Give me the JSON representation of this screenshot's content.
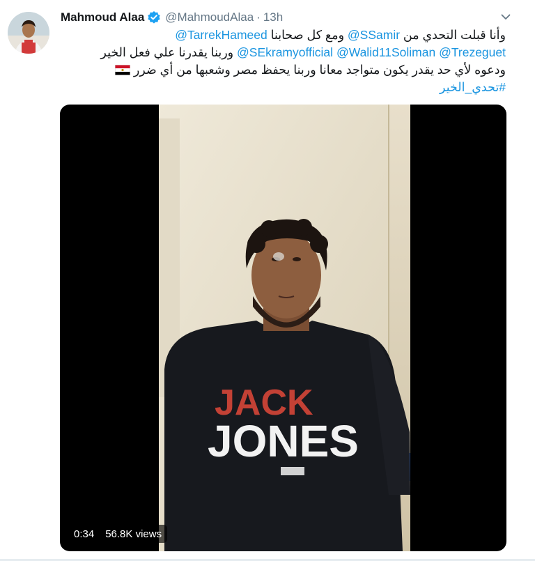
{
  "tweet": {
    "display_name": "Mahmoud Alaa",
    "handle": "@MahmoudAlaa",
    "separator": "·",
    "time": "13h",
    "text": {
      "line1_prefix": "وأنا قبلت التحدي من",
      "line1_mention1": "@SSamir",
      "line1_middle": "ومع كل صحابنا",
      "line1_mention2": "@TarrekHameed",
      "line2_mention1": "@Trezeguet",
      "line2_mention2": "@Walid11Soliman",
      "line2_mention3": "@SEkramyofficial",
      "line2_suffix": "وربنا يقدرنا علي فعل الخير",
      "line3": "ودعوه لأي حد يقدر يكون متواجد معانا وربنا يحفظ مصر وشعبها من أي ضرر",
      "hashtag": "#تحدي_الخير"
    },
    "media": {
      "duration": "0:34",
      "views": "56.8K views"
    }
  },
  "colors": {
    "link": "#1b95e0",
    "verified": "#1da1f2",
    "secondary_text": "#657786"
  },
  "icons": {
    "verified": "verified-badge-icon",
    "caret": "chevron-down-icon",
    "flag": "egypt-flag-icon"
  }
}
